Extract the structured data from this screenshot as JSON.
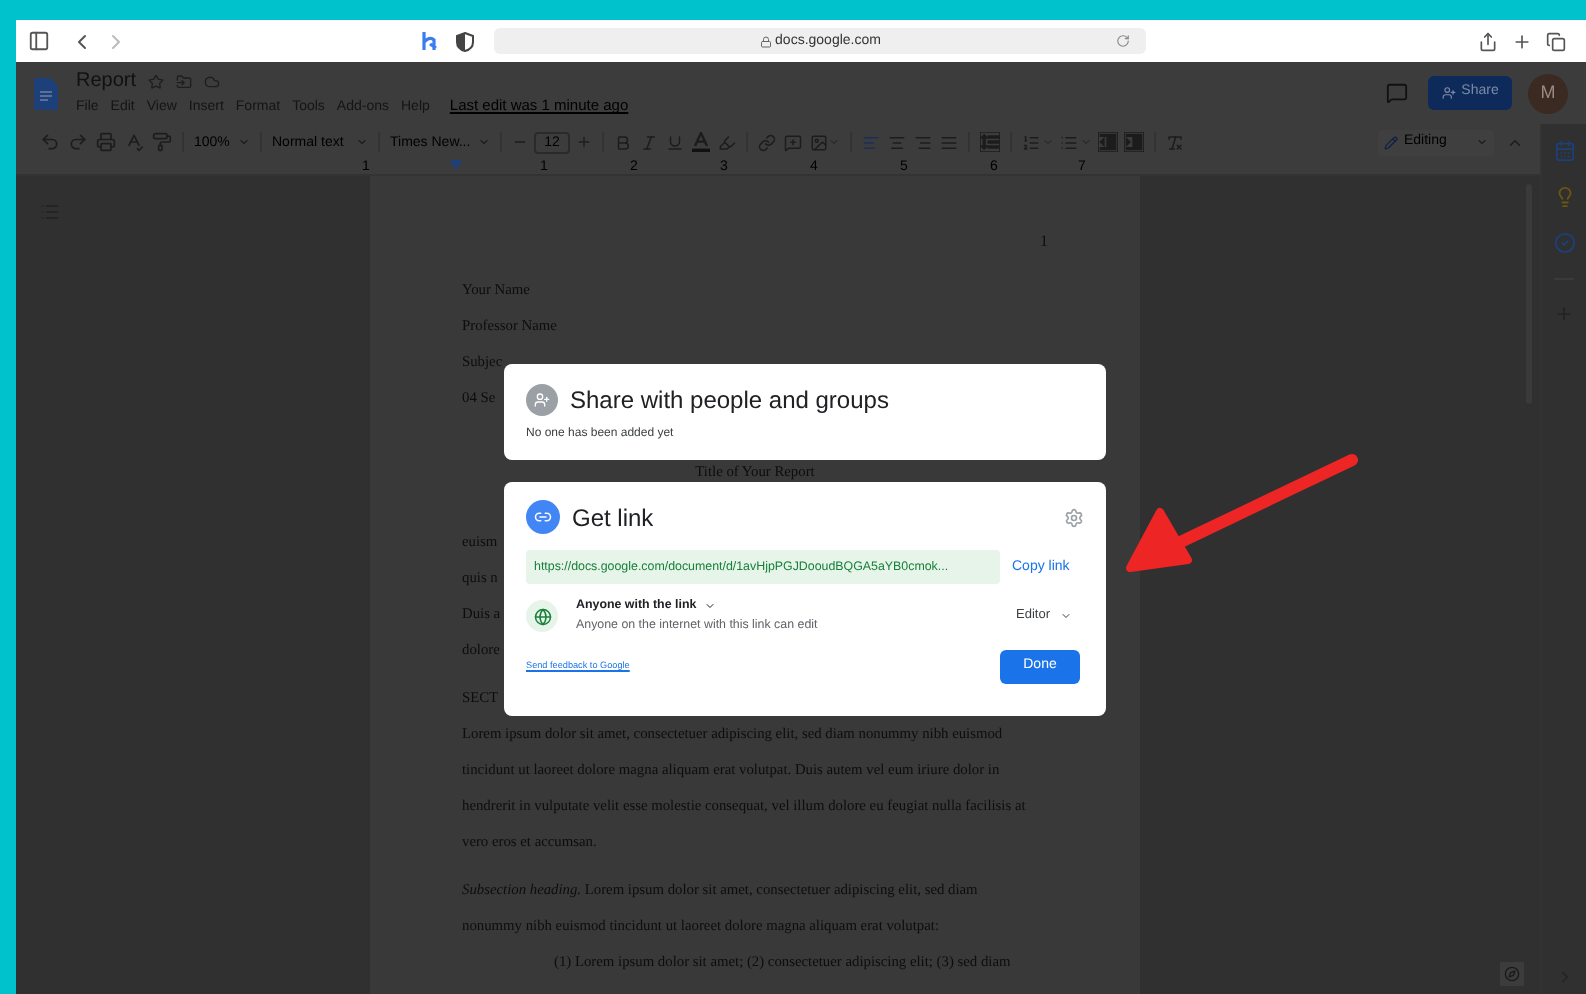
{
  "browser": {
    "address": "docs.google.com"
  },
  "doc_header": {
    "title": "Report",
    "menu": [
      "File",
      "Edit",
      "View",
      "Insert",
      "Format",
      "Tools",
      "Add-ons",
      "Help"
    ],
    "last_edit": "Last edit was 1 minute ago",
    "share_button": "Share",
    "avatar": "M"
  },
  "toolbar": {
    "zoom": "100%",
    "style": "Normal text",
    "font": "Times New...",
    "font_size": "12",
    "mode": "Editing"
  },
  "ruler": [
    "1",
    "1",
    "2",
    "3",
    "4",
    "5",
    "6",
    "7"
  ],
  "page": {
    "page_number": "1",
    "lines": [
      {
        "kind": "line",
        "text": "Your Name"
      },
      {
        "kind": "line",
        "text": "Professor Name"
      },
      {
        "kind": "line",
        "text": "Subjec"
      },
      {
        "kind": "line",
        "text": "04 Se"
      },
      {
        "kind": "title",
        "text": "Title of Your Report"
      },
      {
        "kind": "line",
        "text": "euism"
      },
      {
        "kind": "line",
        "text": "quis n"
      },
      {
        "kind": "line",
        "text": "Duis a"
      },
      {
        "kind": "line",
        "text": "dolore"
      },
      {
        "kind": "paragraph",
        "text": "SECT"
      },
      {
        "kind": "line",
        "text": "Lorem ipsum dolor sit amet, consectetuer adipiscing elit, sed diam nonummy nibh euismod"
      },
      {
        "kind": "line",
        "text": "tincidunt ut laoreet dolore magna aliquam erat volutpat. Duis autem vel eum iriure dolor in"
      },
      {
        "kind": "line",
        "text": "hendrerit in vulputate velit esse molestie consequat, vel illum dolore eu feugiat nulla facilisis at"
      },
      {
        "kind": "line",
        "text": "vero eros et accumsan."
      },
      {
        "kind": "paragraph",
        "text": "*Subsection heading.* Lorem ipsum dolor sit amet, consectetuer adipiscing elit, sed diam"
      },
      {
        "kind": "line",
        "text": "nonummy nibh euismod tincidunt ut laoreet dolore magna aliquam erat volutpat:"
      },
      {
        "kind": "indented",
        "text": "(1) Lorem ipsum dolor sit amet; (2) consectetuer adipiscing elit; (3) sed diam"
      }
    ]
  },
  "share_dialog": {
    "title": "Share with people and groups",
    "subtitle": "No one has been added yet"
  },
  "link_dialog": {
    "title": "Get link",
    "url": "https://docs.google.com/document/d/1avHjpPGJDooudBQGA5aYB0cmok...",
    "copy_button": "Copy link",
    "access": "Anyone with the link",
    "access_note": "Anyone on the internet with this link can edit",
    "role": "Editor",
    "feedback_link": "Send feedback to Google",
    "done_button": "Done"
  }
}
